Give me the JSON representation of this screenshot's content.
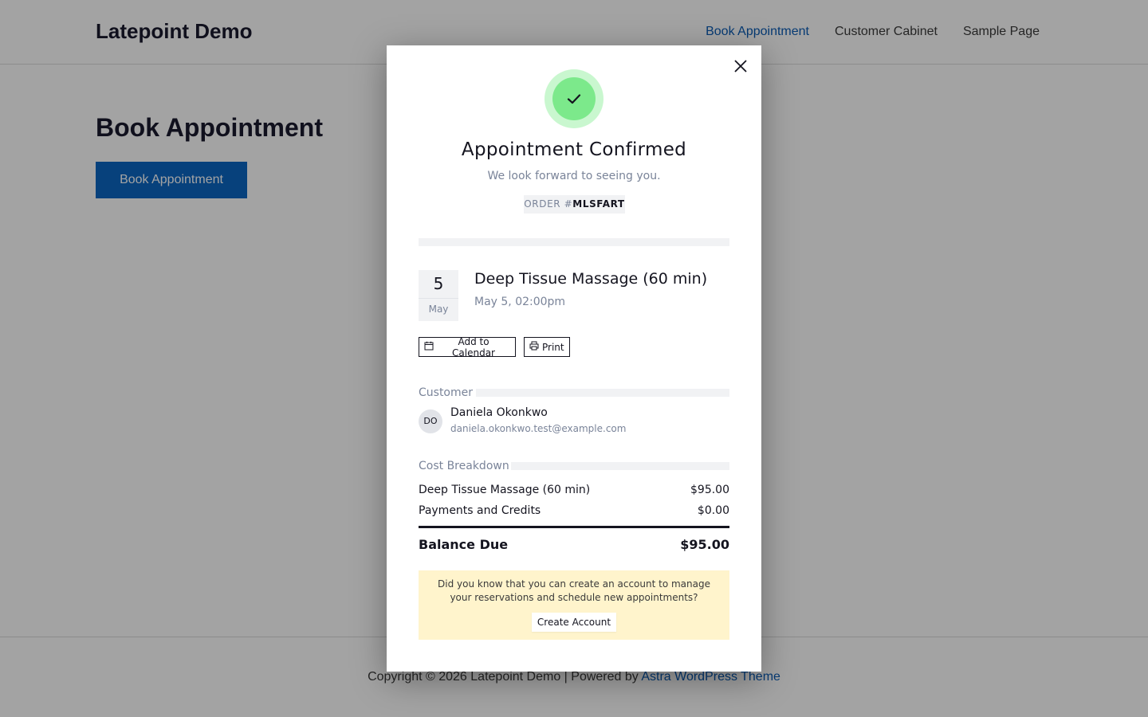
{
  "site": {
    "title": "Latepoint Demo",
    "nav": [
      "Book Appointment",
      "Customer Cabinet",
      "Sample Page"
    ],
    "page_title": "Book Appointment",
    "book_button": "Book Appointment",
    "footer_prefix": "Copyright © 2026 Latepoint Demo | Powered by ",
    "footer_link": "Astra WordPress Theme"
  },
  "modal": {
    "close_icon": "close-icon",
    "success_icon": "checkmark-icon",
    "title": "Appointment Confirmed",
    "subtitle": "We look forward to seeing you.",
    "order_label": "ORDER #",
    "order_code": "MLSFART",
    "date_day": "5",
    "date_month": "May",
    "service_name": "Deep Tissue Massage (60 min)",
    "service_time": "May 5, 02:00pm",
    "add_to_calendar": "Add to Calendar",
    "print": "Print",
    "customer_label": "Customer",
    "customer_initials": "DO",
    "customer_name": "Daniela Okonkwo",
    "customer_email": "daniela.okonkwo.test@example.com",
    "cost_label": "Cost Breakdown",
    "cost_items": [
      {
        "label": "Deep Tissue Massage (60 min)",
        "amount": "$95.00"
      },
      {
        "label": "Payments and Credits",
        "amount": "$0.00"
      }
    ],
    "balance_label": "Balance Due",
    "balance_amount": "$95.00",
    "notice_text": "Did you know that you can create an account to manage your reservations and schedule new appointments?",
    "create_account": "Create Account"
  },
  "colors": {
    "brand_blue": "#0b66c3",
    "success_green": "#7ce98b",
    "notice_yellow": "#fff4cc"
  }
}
